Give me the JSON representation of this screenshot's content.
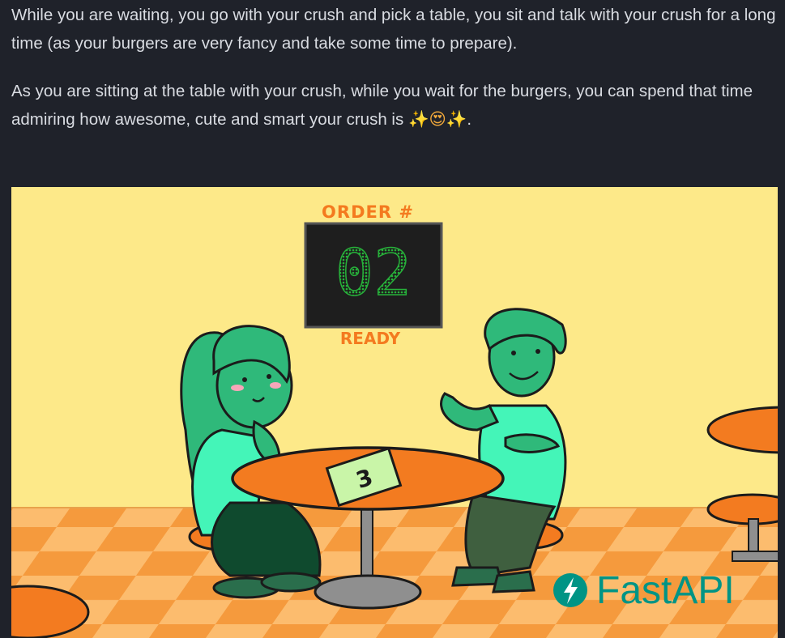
{
  "text": {
    "paragraph_1": "While you are waiting, you go with your crush and pick a table, you sit and talk with your crush for a long time (as your burgers are very fancy and take some time to prepare).",
    "paragraph_2": "As you are sitting at the table with your crush, while you wait for the burgers, you can spend that time admiring how awesome, cute and smart your crush is",
    "emoji_sparkle": "✨",
    "emoji_face": "😍",
    "paragraph_2_end": "."
  },
  "illustration": {
    "order_label": "ORDER #",
    "order_number": "02",
    "ready_label": "READY",
    "table_card_number": "3",
    "brand_name": "FastAPI"
  },
  "colors": {
    "page_background": "#1f222a",
    "text": "#d9dce2",
    "wall": "#fde989",
    "floor_light": "#fcbc6e",
    "floor_dark": "#f59a3d",
    "table_orange": "#f37b20",
    "character_green": "#2fb97a",
    "shirt_mint": "#44f5b8",
    "display_digits": "#27b13a",
    "fastapi_teal": "#009485"
  }
}
